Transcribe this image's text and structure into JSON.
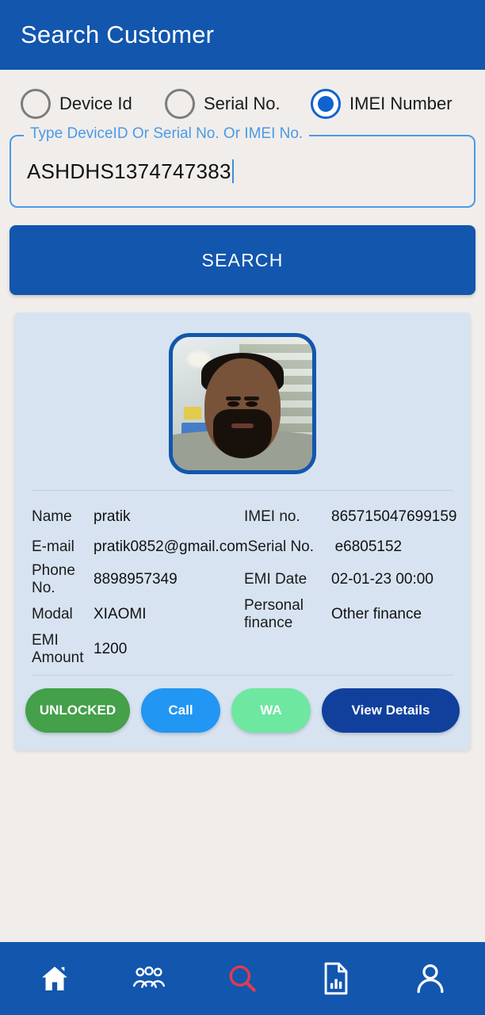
{
  "appbar": {
    "title": "Search Customer"
  },
  "search_type": {
    "options": [
      {
        "label": "Device Id",
        "selected": false,
        "icon": "radio-unchecked-icon"
      },
      {
        "label": "Serial No.",
        "selected": false,
        "icon": "radio-unchecked-icon"
      },
      {
        "label": "IMEI Number",
        "selected": true,
        "icon": "radio-checked-icon"
      }
    ]
  },
  "search_field": {
    "legend": "Type DeviceID Or Serial No. Or IMEI No.",
    "value": "ASHDHS1374747383",
    "placeholder": "Type DeviceID Or Serial No. Or IMEI No."
  },
  "search_button": {
    "label": "SEARCH"
  },
  "result_card": {
    "photo": {
      "alt": "customer-photo",
      "border_color": "#1256ae"
    },
    "rows": [
      {
        "label_left": "Name",
        "value_left": "pratik",
        "label_right": "IMEI no.",
        "value_right": "865715047699159"
      },
      {
        "label_left": "E-mail",
        "value_left": "pratik0852@gmail.com",
        "label_right": "Serial No.",
        "value_right": "e6805152"
      },
      {
        "label_left": "Phone No.",
        "value_left": "8898957349",
        "label_right": "EMI Date",
        "value_right": "02-01-23 00:00"
      },
      {
        "label_left": "Modal",
        "value_left": "XIAOMI",
        "label_right": "Personal finance",
        "value_right": "Other finance"
      },
      {
        "label_left": "EMI Amount",
        "value_left": "1200",
        "label_right": "",
        "value_right": ""
      }
    ],
    "actions": [
      {
        "label": "UNLOCKED",
        "color": "#44a049"
      },
      {
        "label": "Call",
        "color": "#2196f3"
      },
      {
        "label": "WA",
        "color": "#6ee7a0"
      },
      {
        "label": "View Details",
        "color": "#11409c"
      }
    ]
  },
  "bottom_nav": {
    "items": [
      {
        "name": "home-icon",
        "active": false,
        "color": "#ffffff"
      },
      {
        "name": "group-icon",
        "active": false,
        "color": "#ffffff"
      },
      {
        "name": "search-icon",
        "active": true,
        "color": "#e23b4e"
      },
      {
        "name": "report-icon",
        "active": false,
        "color": "#ffffff"
      },
      {
        "name": "profile-icon",
        "active": false,
        "color": "#ffffff"
      }
    ]
  },
  "theme": {
    "primary": "#1256ae",
    "accent": "#4a9ae8",
    "card_bg": "#d7e3f1",
    "page_bg": "#f1edea",
    "active_nav": "#e23b4e"
  }
}
